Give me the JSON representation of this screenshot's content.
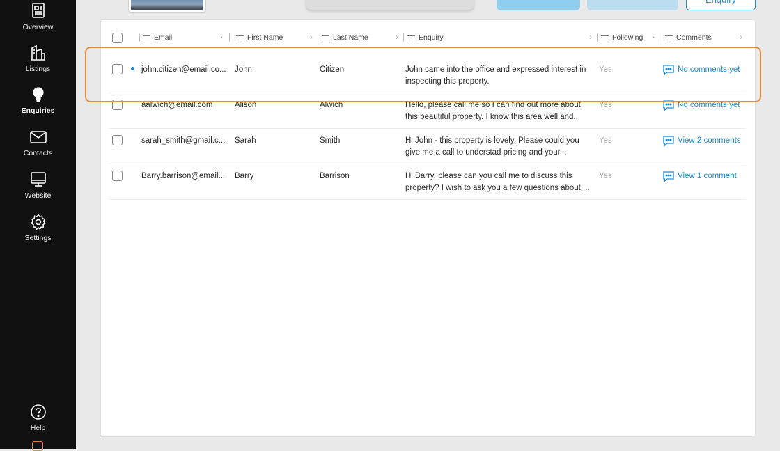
{
  "nav": {
    "items": [
      {
        "label": "Overview",
        "icon": "newspaper-icon"
      },
      {
        "label": "Listings",
        "icon": "buildings-icon"
      },
      {
        "label": "Enquiries",
        "icon": "lightbulb-icon"
      },
      {
        "label": "Contacts",
        "icon": "envelope-icon"
      },
      {
        "label": "Website",
        "icon": "monitor-icon"
      },
      {
        "label": "Settings",
        "icon": "gear-icon"
      }
    ],
    "help": {
      "label": "Help",
      "icon": "help-circle-icon"
    },
    "active": "Enquiries"
  },
  "header": {
    "enquiry_button": "Enquiry"
  },
  "table": {
    "columns": [
      "Email",
      "First Name",
      "Last Name",
      "Enquiry",
      "Following",
      "Comments"
    ],
    "rows": [
      {
        "email": "john.citizen@email.co...",
        "first": "John",
        "last": "Citizen",
        "enquiry": "John came into the office and expressed interest in inspecting this property.",
        "following": "Yes",
        "comments": "No comments yet",
        "unread": true
      },
      {
        "email": "aalwich@email.com",
        "first": "Alison",
        "last": "Alwich",
        "enquiry": "Hello, please call me so I can find out more about this beautiful property. I know this area well and...",
        "following": "Yes",
        "comments": "No comments yet",
        "unread": false
      },
      {
        "email": "sarah_smith@gmail.c...",
        "first": "Sarah",
        "last": "Smith",
        "enquiry": "Hi John - this property is lovely. Please could you give me a call to understad pricing and your...",
        "following": "Yes",
        "comments": "View 2 comments",
        "unread": false
      },
      {
        "email": "Barry.barrison@email...",
        "first": "Barry",
        "last": "Barrison",
        "enquiry": "Hi Barry, please can you call me to discuss this property? I wish to ask you a few questions about ...",
        "following": "Yes",
        "comments": "View 1 comment",
        "unread": false
      }
    ]
  },
  "colors": {
    "accent": "#1a8ad4",
    "sidebar": "#111111",
    "highlight": "#e08a3c",
    "muted": "#a9a9a9"
  }
}
